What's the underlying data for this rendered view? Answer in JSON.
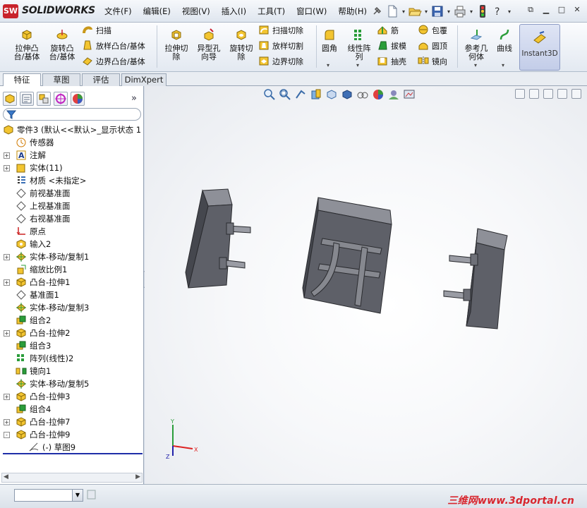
{
  "app": {
    "logo_badge": "SW",
    "logo_text": "SOLIDWORKS"
  },
  "menu": [
    "文件(F)",
    "编辑(E)",
    "视图(V)",
    "插入(I)",
    "工具(T)",
    "窗口(W)",
    "帮助(H)"
  ],
  "quick_access_icons": [
    "pin-icon",
    "new-document-icon",
    "open-folder-icon",
    "save-icon",
    "print-icon",
    "rebuild-traffic-light-icon",
    "help-icon"
  ],
  "window_controls": [
    "restore-icon",
    "minimize-icon",
    "maximize-icon",
    "close-icon"
  ],
  "ribbon": {
    "extrude_boss": "拉伸凸\n台/基体",
    "revolve_boss": "旋转凸\n台/基体",
    "sweep": "扫描",
    "loft_boss": "放样凸台/基体",
    "boundary_boss": "边界凸台/基体",
    "extrude_cut": "拉伸切\n除",
    "hole_wizard": "异型孔\n向导",
    "revolve_cut": "旋转切\n除",
    "sweep_cut": "扫描切除",
    "loft_cut": "放样切割",
    "boundary_cut": "边界切除",
    "fillet": "圆角",
    "linear_pattern": "线性阵\n列",
    "rib": "筋",
    "draft": "拔模",
    "shell": "抽壳",
    "wrap": "包覆",
    "dome": "圆顶",
    "mirror": "镜向",
    "ref_geometry": "参考几\n何体",
    "curves": "曲线",
    "instant3d": "Instant3D"
  },
  "tabs": [
    "特征",
    "草图",
    "评估",
    "DimXpert"
  ],
  "active_tab": 0,
  "feature_tree": [
    {
      "label": "零件3   (默认<<默认>_显示状态 1",
      "icon": "part-icon",
      "indent": 0,
      "expand": ""
    },
    {
      "label": "传感器",
      "icon": "sensor-icon",
      "indent": 1,
      "expand": ""
    },
    {
      "label": "注解",
      "icon": "annotation-icon",
      "indent": 1,
      "expand": "+"
    },
    {
      "label": "实体(11)",
      "icon": "solid-bodies-icon",
      "indent": 1,
      "expand": "+"
    },
    {
      "label": "材质 <未指定>",
      "icon": "material-icon",
      "indent": 1,
      "expand": ""
    },
    {
      "label": "前视基准面",
      "icon": "plane-icon",
      "indent": 1,
      "expand": ""
    },
    {
      "label": "上视基准面",
      "icon": "plane-icon",
      "indent": 1,
      "expand": ""
    },
    {
      "label": "右视基准面",
      "icon": "plane-icon",
      "indent": 1,
      "expand": ""
    },
    {
      "label": "原点",
      "icon": "origin-icon",
      "indent": 1,
      "expand": ""
    },
    {
      "label": "输入2",
      "icon": "imported-feature-icon",
      "indent": 1,
      "expand": ""
    },
    {
      "label": "实体-移动/复制1",
      "icon": "move-copy-body-icon",
      "indent": 1,
      "expand": "+"
    },
    {
      "label": "缩放比例1",
      "icon": "scale-icon",
      "indent": 1,
      "expand": ""
    },
    {
      "label": "凸台-拉伸1",
      "icon": "extrude-boss-icon",
      "indent": 1,
      "expand": "+"
    },
    {
      "label": "基准面1",
      "icon": "plane-icon",
      "indent": 1,
      "expand": ""
    },
    {
      "label": "实体-移动/复制3",
      "icon": "move-copy-body-icon",
      "indent": 1,
      "expand": ""
    },
    {
      "label": "组合2",
      "icon": "combine-icon",
      "indent": 1,
      "expand": ""
    },
    {
      "label": "凸台-拉伸2",
      "icon": "extrude-boss-icon",
      "indent": 1,
      "expand": "+"
    },
    {
      "label": "组合3",
      "icon": "combine-icon",
      "indent": 1,
      "expand": ""
    },
    {
      "label": "阵列(线性)2",
      "icon": "linear-pattern-icon",
      "indent": 1,
      "expand": ""
    },
    {
      "label": "镜向1",
      "icon": "mirror-icon",
      "indent": 1,
      "expand": ""
    },
    {
      "label": "实体-移动/复制5",
      "icon": "move-copy-body-icon",
      "indent": 1,
      "expand": ""
    },
    {
      "label": "凸台-拉伸3",
      "icon": "extrude-boss-icon",
      "indent": 1,
      "expand": "+"
    },
    {
      "label": "组合4",
      "icon": "combine-icon",
      "indent": 1,
      "expand": ""
    },
    {
      "label": "凸台-拉伸7",
      "icon": "extrude-boss-icon",
      "indent": 1,
      "expand": "+"
    },
    {
      "label": "凸台-拉伸9",
      "icon": "extrude-boss-icon",
      "indent": 1,
      "expand": "-"
    },
    {
      "label": "(-) 草图9",
      "icon": "sketch-icon",
      "indent": 2,
      "expand": ""
    }
  ],
  "triad": {
    "x": "X",
    "y": "Y",
    "z": "Z"
  },
  "status": {
    "watermark": "三维网www.3dportal.cn"
  },
  "colors": {
    "brand_red": "#c8232b",
    "body_face": "#5e6068",
    "body_side": "#4a4c54",
    "body_top": "#8e9098",
    "tree_end_line": "#1f2fa8"
  }
}
